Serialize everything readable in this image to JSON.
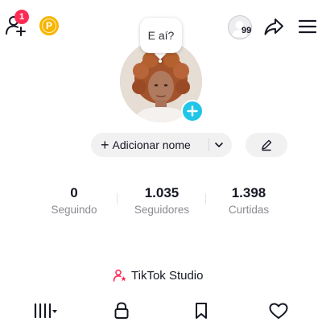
{
  "topbar": {
    "notification_count": "1",
    "coin_letter": "P",
    "profile_views": "99"
  },
  "profile": {
    "bubble_text": "E aí?",
    "add_name_label": "Adicionar nome"
  },
  "stats": [
    {
      "value": "0",
      "label": "Seguindo"
    },
    {
      "value": "1.035",
      "label": "Seguidores"
    },
    {
      "value": "1.398",
      "label": "Curtidas"
    }
  ],
  "studio": {
    "label": "TikTok Studio"
  },
  "colors": {
    "accent_red": "#fe2c55",
    "story_blue": "#20c5e8",
    "coin_gold": "#f7b500",
    "muted_text": "#8a8b91"
  },
  "icons": {
    "add_friend": "person-plus-icon",
    "share": "share-arrow-icon",
    "menu": "hamburger-menu-icon",
    "videos_tab": "grid-bars-icon",
    "private_tab": "lock-icon",
    "saved_tab": "bookmark-icon",
    "liked_tab": "heart-icon"
  }
}
